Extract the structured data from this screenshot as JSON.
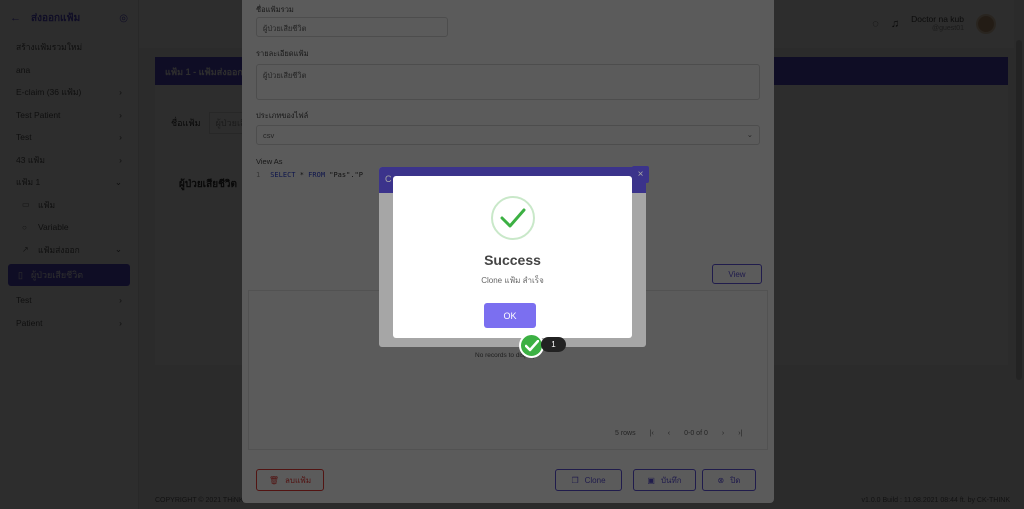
{
  "sidebar": {
    "title": "ส่งออกแฟ้ม",
    "items": [
      {
        "label": "สร้างแฟ้มรวมใหม่",
        "chevron": false
      },
      {
        "label": "ana",
        "chevron": false
      },
      {
        "label": "E-claim (36 แฟ้ม)",
        "chevron": true
      },
      {
        "label": "Test Patient",
        "chevron": true
      },
      {
        "label": "Test",
        "chevron": true
      },
      {
        "label": "43 แฟ้ม",
        "chevron": true
      },
      {
        "label": "แฟ้ม 1",
        "chevron": true
      }
    ],
    "sub_items": [
      "แฟ้ม",
      "Variable",
      "แฟ้มส่งออก"
    ],
    "active_item": "ผู้ป่วยเสียชีวิต",
    "tail_items": [
      "Test",
      "Patient"
    ]
  },
  "topbar": {
    "user_name": "Doctor na kub",
    "user_sub": "@guest01"
  },
  "page": {
    "header": "แฟ้ม 1 - แฟ้มส่งออก",
    "filter_label": "ชื่อแฟ้ม",
    "filter_placeholder": "ผู้ป่วยเสียชีวิต",
    "subtitle": "ผู้ป่วยเสียชีวิต",
    "footer_left": "COPYRIGHT © 2021 THiNK",
    "footer_right": "v1.0.0 Build : 11.08.2021 08:44 ft. by CK-THINK"
  },
  "drawer": {
    "name_label": "ชื่อแฟ้มรวม",
    "name_value": "ผู้ป่วยเสียชีวิต",
    "detail_label": "รายละเอียดแฟ้ม",
    "detail_value": "ผู้ป่วยเสียชีวิต",
    "type_label": "ประเภทของไฟล์",
    "type_value": "csv",
    "view_as_label": "View As",
    "code_line_no": "1",
    "code_kw1": "SELECT",
    "code_mid": " * ",
    "code_kw2": "FROM",
    "code_rest": " \"Pas\".\"P",
    "view_button": "View",
    "no_records": "No records to display",
    "pager_rows": "5 rows",
    "pager_range": "0-0 of 0",
    "delete_button": "ลบแฟ้ม",
    "clone_button": "Clone",
    "save_button": "บันทึก",
    "close_button": "ปิด"
  },
  "clone_modal": {
    "header": "C",
    "close": "×"
  },
  "success_modal": {
    "title": "Success",
    "message": "Clone แฟ้ม สำเร็จ",
    "ok_label": "OK"
  },
  "step_badge": "1",
  "colors": {
    "accent": "#5b4fd6",
    "success": "#3cb043",
    "danger": "#e53935"
  }
}
